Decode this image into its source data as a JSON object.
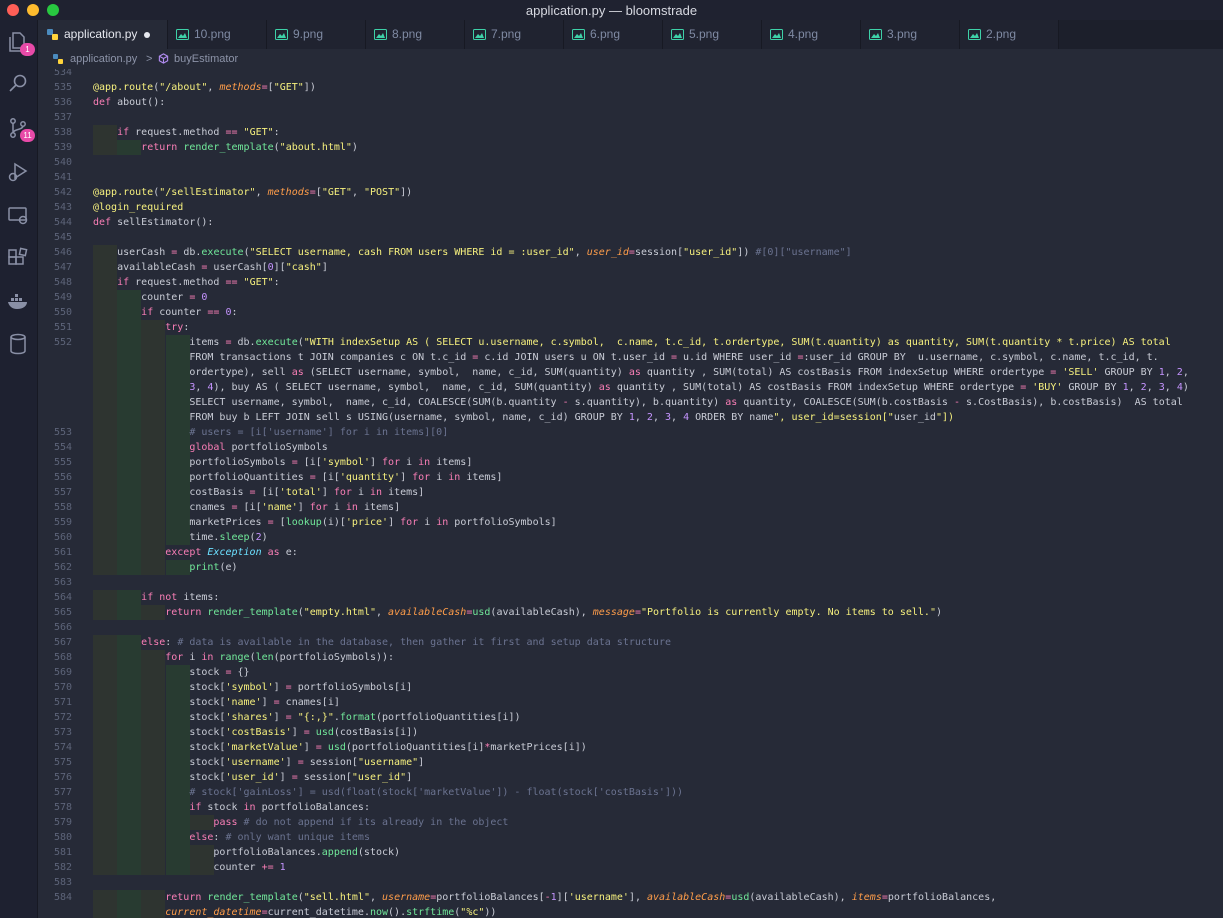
{
  "window": {
    "title": "application.py — bloomstrade"
  },
  "activity_bar": {
    "explorer_badge": "1",
    "source_control_badge": "11"
  },
  "tabs": [
    {
      "label": "application.py",
      "dirty": true
    },
    {
      "label": "10.png"
    },
    {
      "label": "9.png"
    },
    {
      "label": "8.png"
    },
    {
      "label": "7.png"
    },
    {
      "label": "6.png"
    },
    {
      "label": "5.png"
    },
    {
      "label": "4.png"
    },
    {
      "label": "3.png"
    },
    {
      "label": "2.png"
    }
  ],
  "breadcrumb": {
    "file": "application.py",
    "separator": ">",
    "symbol": "buyEstimator"
  },
  "code_lines": [
    {
      "num": "534",
      "text": ""
    },
    {
      "num": "535",
      "text": "@app.route(\"/about\", methods=[\"GET\"])"
    },
    {
      "num": "536",
      "text": "def about():"
    },
    {
      "num": "537",
      "text": ""
    },
    {
      "num": "538",
      "text": "    if request.method == \"GET\":"
    },
    {
      "num": "539",
      "text": "        return render_template(\"about.html\")"
    },
    {
      "num": "540",
      "text": ""
    },
    {
      "num": "541",
      "text": ""
    },
    {
      "num": "542",
      "text": "@app.route(\"/sellEstimator\", methods=[\"GET\", \"POST\"])"
    },
    {
      "num": "543",
      "text": "@login_required"
    },
    {
      "num": "544",
      "text": "def sellEstimator():"
    },
    {
      "num": "545",
      "text": ""
    },
    {
      "num": "546",
      "text": "    userCash = db.execute(\"SELECT username, cash FROM users WHERE id = :user_id\", user_id=session[\"user_id\"]) #[0][\"username\"]"
    },
    {
      "num": "547",
      "text": "    availableCash = userCash[0][\"cash\"]"
    },
    {
      "num": "548",
      "text": "    if request.method == \"GET\":"
    },
    {
      "num": "549",
      "text": "        counter = 0"
    },
    {
      "num": "550",
      "text": "        if counter == 0:"
    },
    {
      "num": "551",
      "text": "            try:"
    },
    {
      "num": "552",
      "text": "                items = db.execute(\"WITH indexSetup AS ( SELECT u.username, c.symbol,  c.name, t.c_id, t.ordertype, SUM(t.quantity) as quantity, SUM(t.quantity * t.price) AS total"
    },
    {
      "num": "",
      "text": "                FROM transactions t JOIN companies c ON t.c_id = c.id JOIN users u ON t.user_id = u.id WHERE user_id =:user_id GROUP BY  u.username, c.symbol, c.name, t.c_id, t."
    },
    {
      "num": "",
      "text": "                ordertype), sell as (SELECT username, symbol,  name, c_id, SUM(quantity) as quantity , SUM(total) AS costBasis FROM indexSetup WHERE ordertype = 'SELL' GROUP BY 1, 2,"
    },
    {
      "num": "",
      "text": "                3, 4), buy AS ( SELECT username, symbol,  name, c_id, SUM(quantity) as quantity , SUM(total) AS costBasis FROM indexSetup WHERE ordertype = 'BUY' GROUP BY 1, 2, 3, 4)"
    },
    {
      "num": "",
      "text": "                SELECT username, symbol,  name, c_id, COALESCE(SUM(b.quantity - s.quantity), b.quantity) as quantity, COALESCE(SUM(b.costBasis - s.CostBasis), b.costBasis)  AS total"
    },
    {
      "num": "",
      "text": "                FROM buy b LEFT JOIN sell s USING(username, symbol, name, c_id) GROUP BY 1, 2, 3, 4 ORDER BY name\", user_id=session[\"user_id\"])"
    },
    {
      "num": "553",
      "text": "                # users = [i['username'] for i in items][0]"
    },
    {
      "num": "554",
      "text": "                global portfolioSymbols"
    },
    {
      "num": "555",
      "text": "                portfolioSymbols = [i['symbol'] for i in items]"
    },
    {
      "num": "556",
      "text": "                portfolioQuantities = [i['quantity'] for i in items]"
    },
    {
      "num": "557",
      "text": "                costBasis = [i['total'] for i in items]"
    },
    {
      "num": "558",
      "text": "                cnames = [i['name'] for i in items]"
    },
    {
      "num": "559",
      "text": "                marketPrices = [lookup(i)['price'] for i in portfolioSymbols]"
    },
    {
      "num": "560",
      "text": "                time.sleep(2)"
    },
    {
      "num": "561",
      "text": "            except Exception as e:"
    },
    {
      "num": "562",
      "text": "                print(e)"
    },
    {
      "num": "563",
      "text": ""
    },
    {
      "num": "564",
      "text": "        if not items:"
    },
    {
      "num": "565",
      "text": "            return render_template(\"empty.html\", availableCash=usd(availableCash), message=\"Portfolio is currently empty. No items to sell.\")"
    },
    {
      "num": "566",
      "text": ""
    },
    {
      "num": "567",
      "text": "        else: # data is available in the database, then gather it first and setup data structure"
    },
    {
      "num": "568",
      "text": "            for i in range(len(portfolioSymbols)):"
    },
    {
      "num": "569",
      "text": "                stock = {}"
    },
    {
      "num": "570",
      "text": "                stock['symbol'] = portfolioSymbols[i]"
    },
    {
      "num": "571",
      "text": "                stock['name'] = cnames[i]"
    },
    {
      "num": "572",
      "text": "                stock['shares'] = \"{:,}\".format(portfolioQuantities[i])"
    },
    {
      "num": "573",
      "text": "                stock['costBasis'] = usd(costBasis[i])"
    },
    {
      "num": "574",
      "text": "                stock['marketValue'] = usd(portfolioQuantities[i]*marketPrices[i])"
    },
    {
      "num": "575",
      "text": "                stock['username'] = session[\"username\"]"
    },
    {
      "num": "576",
      "text": "                stock['user_id'] = session[\"user_id\"]"
    },
    {
      "num": "577",
      "text": "                # stock['gainLoss'] = usd(float(stock['marketValue']) - float(stock['costBasis']))"
    },
    {
      "num": "578",
      "text": "                if stock in portfolioBalances:"
    },
    {
      "num": "579",
      "text": "                    pass # do not append if its already in the object"
    },
    {
      "num": "580",
      "text": "                else: # only want unique items"
    },
    {
      "num": "581",
      "text": "                    portfolioBalances.append(stock)"
    },
    {
      "num": "582",
      "text": "                    counter += 1"
    },
    {
      "num": "583",
      "text": ""
    },
    {
      "num": "584",
      "text": "            return render_template(\"sell.html\", username=portfolioBalances[-1]['username'], availableCash=usd(availableCash), items=portfolioBalances,"
    },
    {
      "num": "",
      "text": "            current_datetime=current_datetime.now().strftime(\"%c\"))"
    }
  ],
  "colors": {
    "editor_bg": "#262a37",
    "keyword": "#f97eb6",
    "function": "#71e89a",
    "string": "#f6f07e",
    "comment": "#6b7390",
    "number": "#c594ff",
    "parameter": "#ff9d4a"
  }
}
